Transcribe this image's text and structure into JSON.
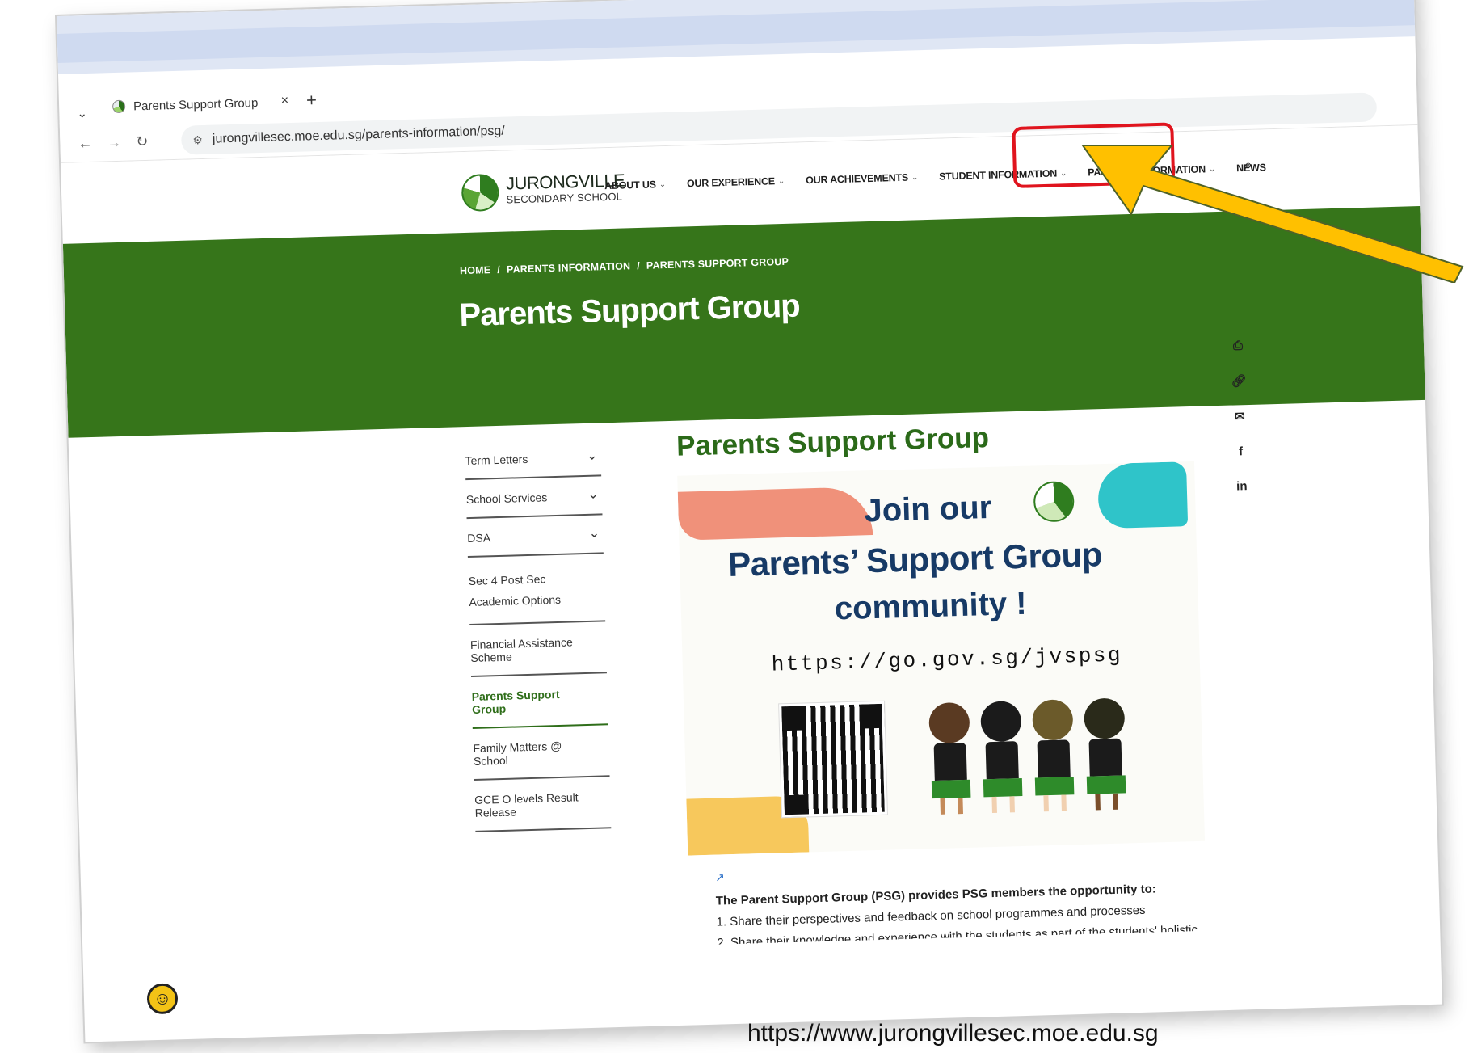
{
  "browser": {
    "tab_title": "Parents Support Group",
    "tab_close": "×",
    "new_tab": "+",
    "url": "jurongvillesec.moe.edu.sg/parents-information/psg/"
  },
  "site": {
    "logo_line1": "JURONGVILLE",
    "logo_line2": "SECONDARY SCHOOL",
    "nav": [
      {
        "label": "ABOUT US"
      },
      {
        "label": "OUR EXPERIENCE"
      },
      {
        "label": "OUR ACHIEVEMENTS"
      },
      {
        "label": "STUDENT INFORMATION"
      },
      {
        "label": "PARENTS INFORMATION"
      },
      {
        "label": "NEWS"
      }
    ]
  },
  "banner": {
    "breadcrumb": [
      "HOME",
      "/",
      "PARENTS INFORMATION",
      "/",
      "PARENTS SUPPORT GROUP"
    ],
    "title": "Parents Support Group"
  },
  "sidebar": {
    "items": [
      {
        "label": "Term Letters",
        "chevron": true
      },
      {
        "label": "School Services",
        "chevron": true
      },
      {
        "label": "DSA",
        "chevron": true
      },
      {
        "label": "Sec 4 Post Sec Academic Options",
        "chevron": false
      },
      {
        "label": "Financial Assistance Scheme",
        "chevron": false
      },
      {
        "label": "Parents Support Group",
        "chevron": false,
        "active": true
      },
      {
        "label": "Family Matters @ School",
        "chevron": false
      },
      {
        "label": "GCE O levels Result Release",
        "chevron": false
      }
    ]
  },
  "content": {
    "title": "Parents Support Group",
    "poster": {
      "line1": "Join our",
      "line2": "Parents’ Support Group",
      "line3": "community !",
      "url": "https://go.gov.sg/jvspsg"
    },
    "lead": "The Parent Support Group (PSG) provides PSG members the opportunity to:",
    "point1": "1. Share their perspectives and feedback on school programmes and processes",
    "point2": "2. Share their knowledge and experience with the students as part of the students' holistic"
  },
  "share": [
    "print-icon",
    "link-icon",
    "mail-icon",
    "facebook-icon",
    "linkedin-icon"
  ],
  "caption": "https://www.jurongvillesec.moe.edu.sg",
  "colors": {
    "banner_green": "#36751a",
    "highlight_red": "#e0141e",
    "arrow_yellow": "#ffc000"
  }
}
